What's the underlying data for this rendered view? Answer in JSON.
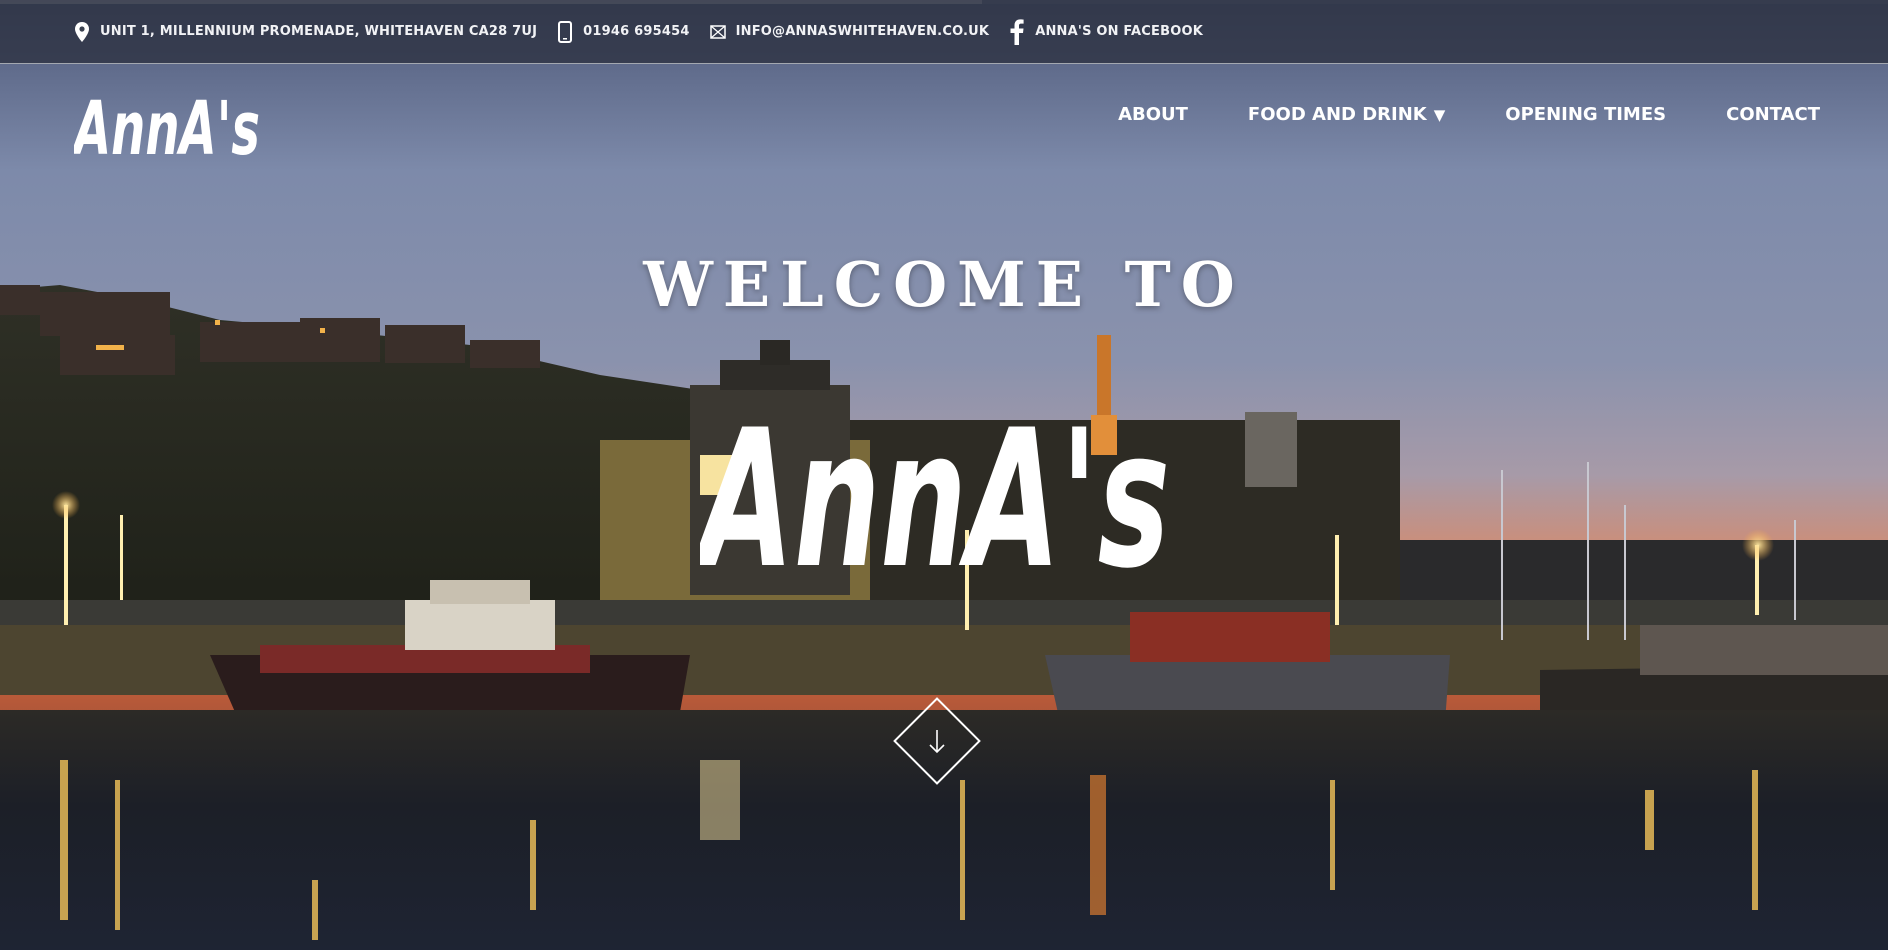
{
  "contact_bar": {
    "address": "UNIT 1, MILLENNIUM PROMENADE, WHITEHAVEN CA28 7UJ",
    "phone": "01946 695454",
    "email": "INFO@ANNASWHITEHAVEN.CO.UK",
    "facebook": "ANNA'S ON FACEBOOK"
  },
  "brand": {
    "logo_text": "AnnA's"
  },
  "nav": {
    "items": [
      {
        "label": "ABOUT"
      },
      {
        "label": "FOOD AND DRINK",
        "has_dropdown": true,
        "caret": "▼"
      },
      {
        "label": "OPENING TIMES"
      },
      {
        "label": "CONTACT"
      }
    ]
  },
  "hero": {
    "welcome": "WELCOME TO",
    "title": "AnnA's",
    "scroll_icon": "arrow-down-icon"
  },
  "colors": {
    "sky_top": "#5c6a8c",
    "sky_horizon": "#e8744a",
    "water": "#14171f",
    "text": "#ffffff"
  }
}
